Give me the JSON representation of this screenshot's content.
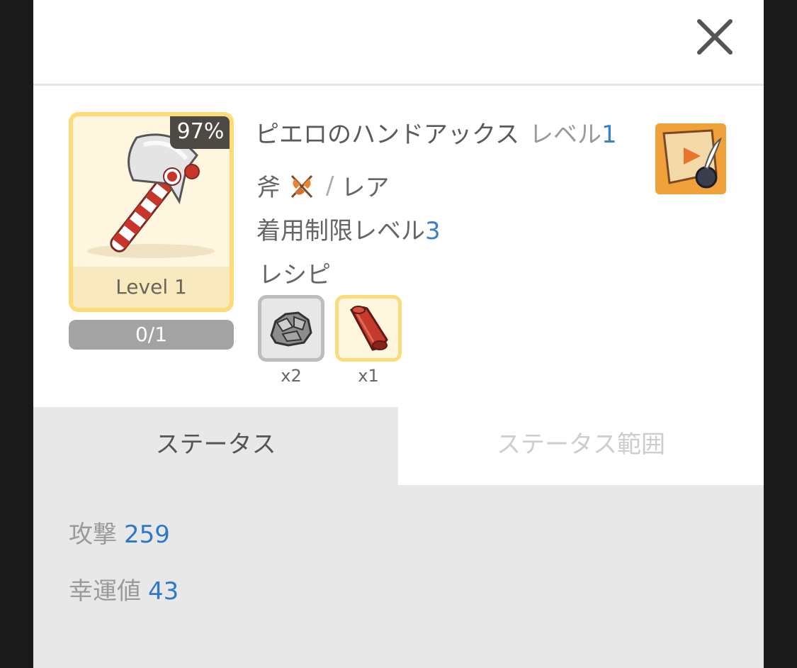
{
  "item": {
    "name": "ピエロのハンドアックス",
    "level_label": "レベル",
    "level_value": "1",
    "type": "斧",
    "rarity": "レア",
    "type_icon": "battle-axe-icon",
    "restriction_label": "着用制限レベル",
    "restriction_value": "3",
    "card": {
      "percent": "97%",
      "level_text": "Level 1",
      "progress_text": "0/1",
      "progress_fraction": 0
    }
  },
  "recipe": {
    "title": "レシピ",
    "materials": [
      {
        "icon": "stone-ore-icon",
        "qty": "x2"
      },
      {
        "icon": "red-cloth-roll-icon",
        "qty": "x1"
      }
    ]
  },
  "tabs": [
    {
      "label": "ステータス",
      "active": true
    },
    {
      "label": "ステータス範囲",
      "active": false
    }
  ],
  "stats": [
    {
      "label": "攻撃",
      "value": "259"
    },
    {
      "label": "幸運値",
      "value": "43"
    }
  ],
  "colors": {
    "accent_blue": "#3d7ec7",
    "card_border": "#fbdc79",
    "card_bg": "#fef6de",
    "badge_bg": "#4d4a44",
    "scroll_button_bg": "#f1a13a"
  }
}
